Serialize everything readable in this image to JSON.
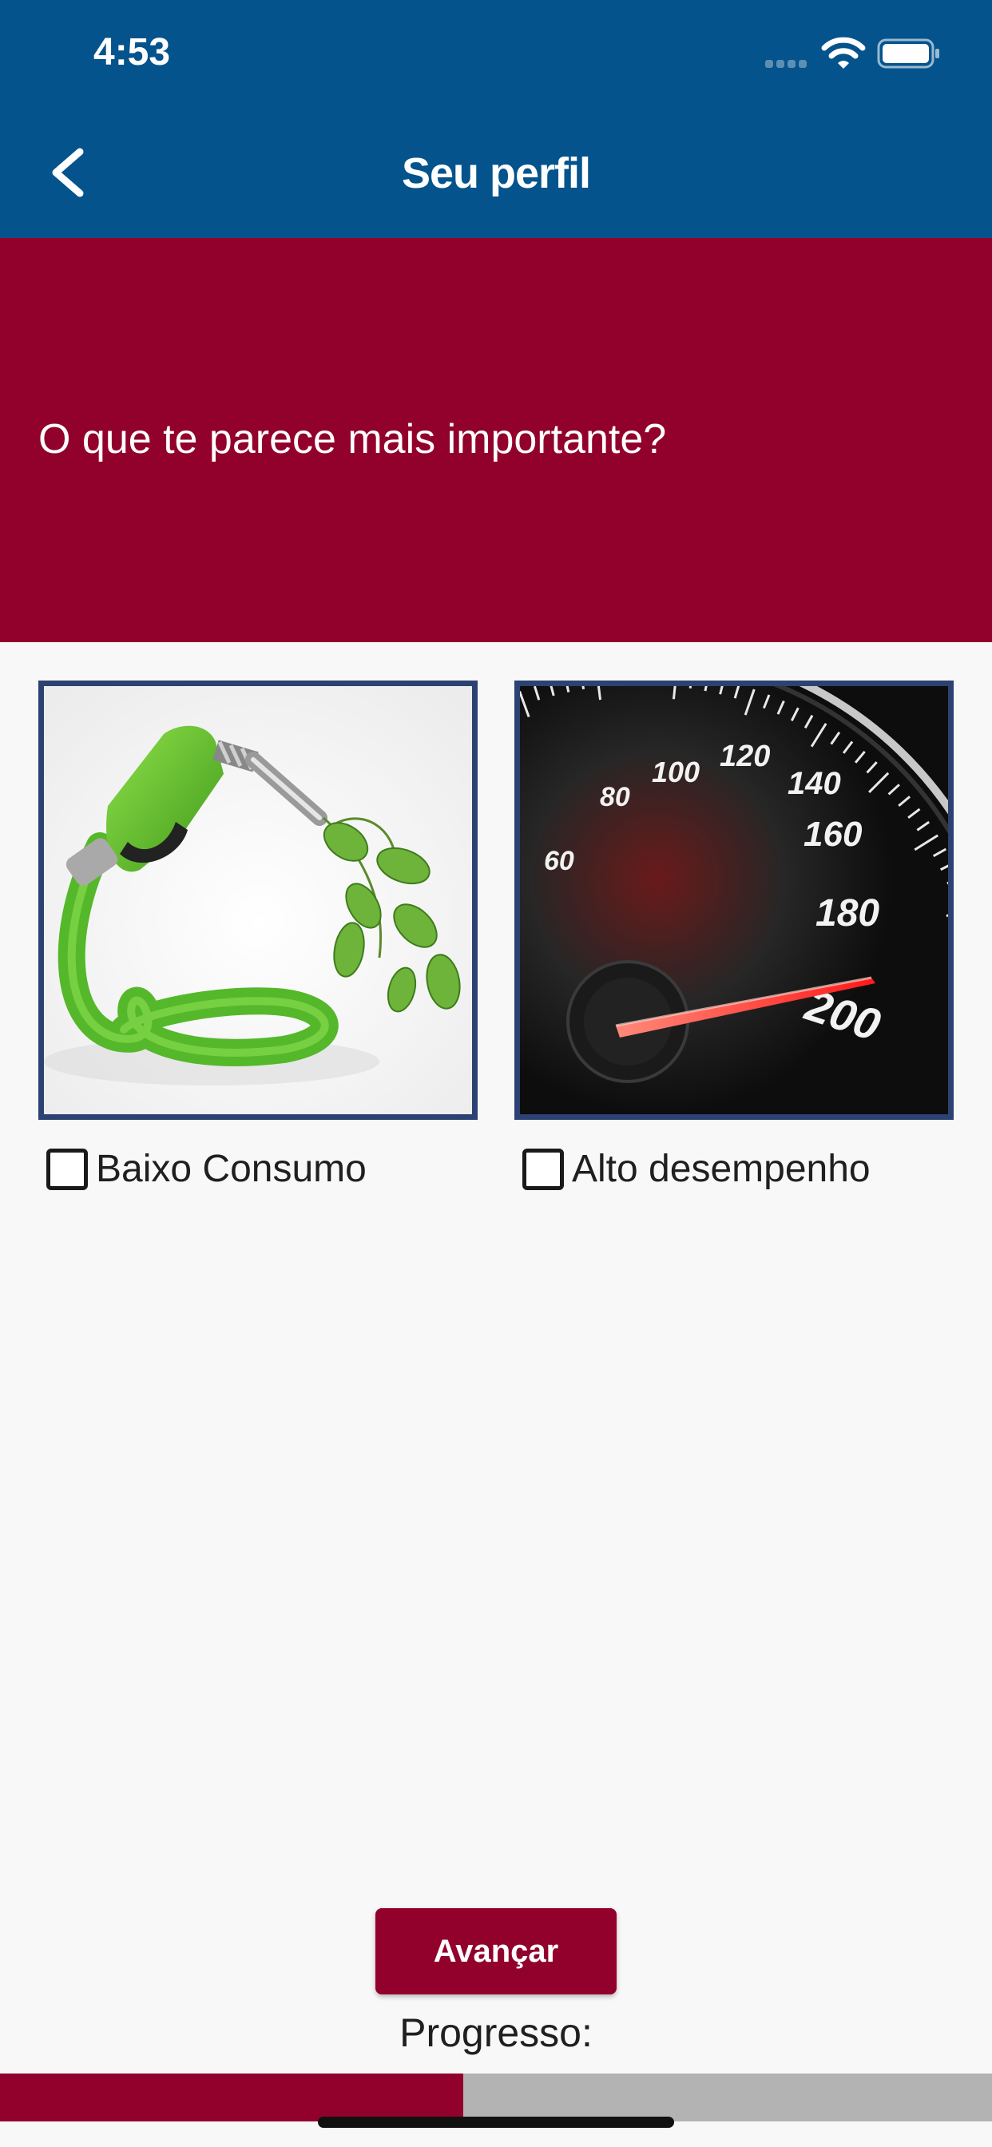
{
  "status_bar": {
    "time": "4:53",
    "icons": [
      "signal-icon",
      "wifi-icon",
      "battery-icon"
    ]
  },
  "header": {
    "title": "Seu perfil",
    "back_icon": "chevron-left-icon"
  },
  "question": {
    "text": "O que te parece mais importante?"
  },
  "options": [
    {
      "label": "Baixo Consumo",
      "image": "green-fuel-nozzle-with-leaves",
      "checked": false
    },
    {
      "label": "Alto desempenho",
      "image": "speedometer-gauge",
      "checked": false
    }
  ],
  "speedometer_ticks": [
    "60",
    "80",
    "100",
    "120",
    "140",
    "160",
    "180",
    "200"
  ],
  "actions": {
    "advance_label": "Avançar"
  },
  "progress": {
    "label": "Progresso:",
    "fraction": 0.467
  },
  "colors": {
    "header_blue": "#04538c",
    "accent_crimson": "#92002c",
    "card_border": "#2b4272",
    "progress_track": "#b3b3b3",
    "background": "#f8f8f8"
  }
}
